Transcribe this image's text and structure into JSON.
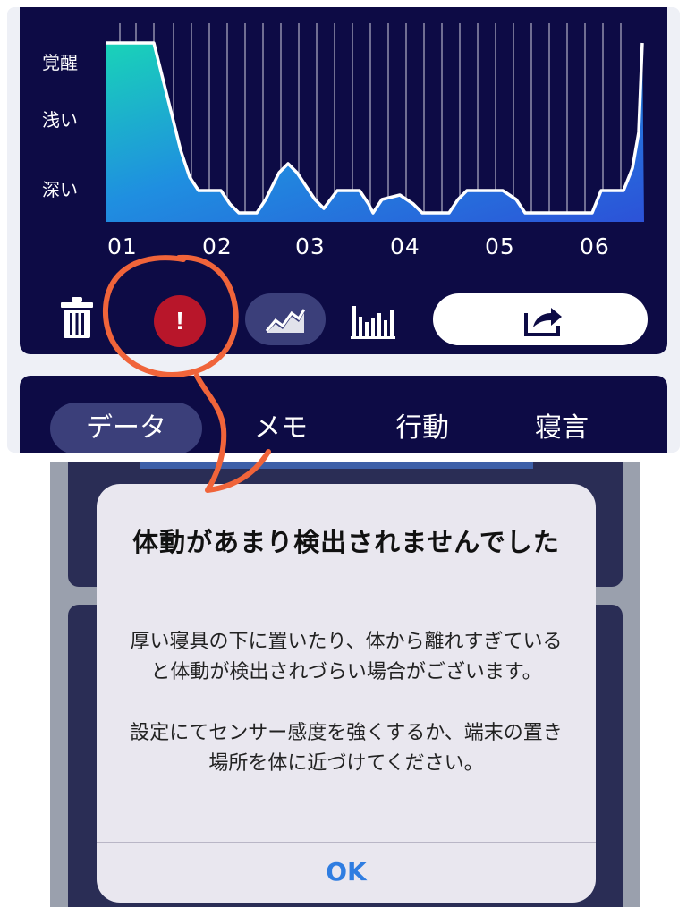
{
  "graph": {
    "y_labels": [
      "覚醒",
      "浅い",
      "深い"
    ],
    "x_labels": [
      "01",
      "02",
      "03",
      "04",
      "05",
      "06"
    ]
  },
  "toolbar": {
    "delete_icon": "trash-icon",
    "alert_symbol": "!",
    "line_chart_icon": "line-chart-icon",
    "bar_chart_icon": "bar-chart-icon",
    "share_icon": "share-icon"
  },
  "tabs": [
    {
      "label": "データ",
      "active": true
    },
    {
      "label": "メモ",
      "active": false
    },
    {
      "label": "行動",
      "active": false
    },
    {
      "label": "寝言",
      "active": false
    }
  ],
  "alert": {
    "title": "体動があまり検出されませんでした",
    "message": "厚い寝具の下に置いたり、体から離れすぎていると体動が検出されづらい場合がございます。\n\n設定にてセンサー感度を強くするか、端末の置き場所を体に近づけてください。",
    "ok_label": "OK"
  },
  "colors": {
    "app_bg": "#0d0b45",
    "alert_red": "#b8162a",
    "annotation": "#f0643a",
    "ok_blue": "#2f7de1"
  }
}
